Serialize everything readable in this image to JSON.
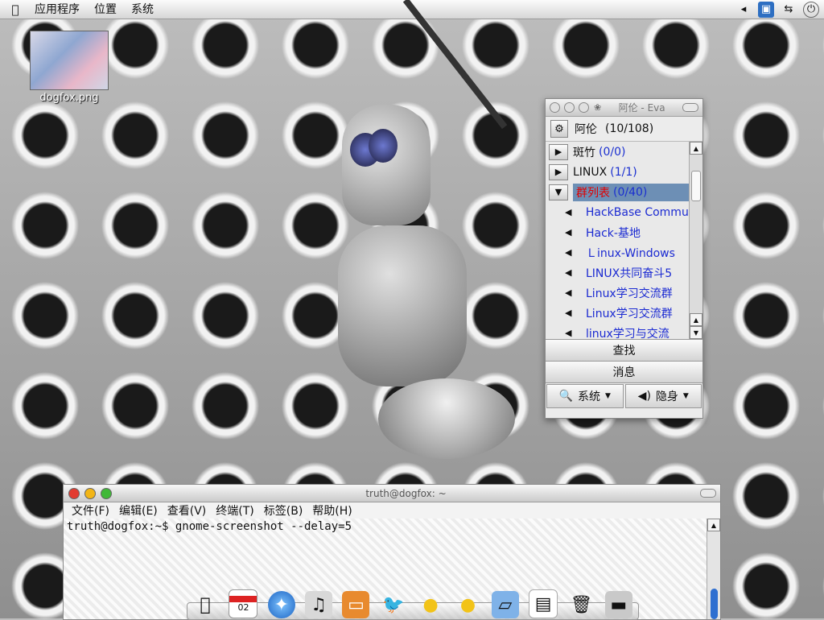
{
  "top_panel": {
    "menus": [
      "应用程序",
      "位置",
      "系统"
    ],
    "tray_icons": [
      "volume-left-arrow-icon",
      "screenshot-icon",
      "network-icon",
      "power-icon"
    ]
  },
  "desktop": {
    "icon_label": "dogfox.png"
  },
  "eva": {
    "title": "阿伦 - Eva",
    "user": "阿伦",
    "user_count": "(10/108)",
    "groups": [
      {
        "name": "斑竹",
        "count": "(0/0)",
        "expanded": false
      },
      {
        "name": "LINUX",
        "count": "(1/1)",
        "expanded": false
      },
      {
        "name": "群列表",
        "count": "(0/40)",
        "expanded": true
      }
    ],
    "group_items": [
      "HackBase Communit",
      "Hack-基地",
      "Ｌinux-Windows",
      "LINUX共同奋斗5",
      "Linux学习交流群",
      "Linux学习交流群",
      "linux学习与交流"
    ],
    "buttons": {
      "search": "查找",
      "messages": "消息",
      "system": "系统",
      "status": "隐身"
    }
  },
  "terminal": {
    "title": "truth@dogfox: ~",
    "menus": [
      "文件(F)",
      "编辑(E)",
      "查看(V)",
      "终端(T)",
      "标签(B)",
      "帮助(H)"
    ],
    "command_line": "truth@dogfox:~$ gnome-screenshot --delay=5"
  },
  "dock": {
    "icons": [
      "apple-icon",
      "calendar-icon",
      "safari-icon",
      "itunes-icon",
      "presentation-icon",
      "bird-icon",
      "duck-icon",
      "duck-icon",
      "folder-icon",
      "chart-icon",
      "trash-icon",
      "drive-icon"
    ],
    "calendar_day": "02"
  }
}
